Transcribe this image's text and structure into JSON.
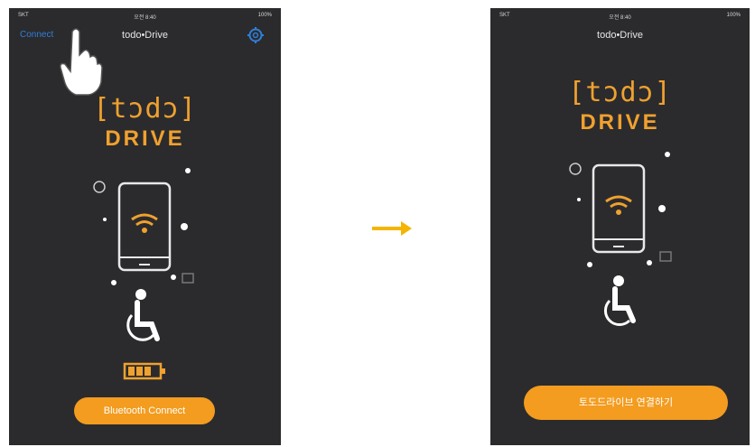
{
  "left_screen": {
    "status_bar": {
      "carrier": "SKT",
      "time": "오전 8:40",
      "battery": "100%"
    },
    "nav": {
      "title": "todo•Drive",
      "left_button": "Connect"
    },
    "logo": {
      "line1": "[tɔdɔ]",
      "line2": "DRIVE"
    },
    "cta_label": "Bluetooth Connect"
  },
  "right_screen": {
    "status_bar": {
      "carrier": "SKT",
      "time": "오전 8:40",
      "battery": "100%"
    },
    "nav": {
      "title": "todo•Drive"
    },
    "logo": {
      "line1": "[tɔdɔ]",
      "line2": "DRIVE"
    },
    "cta_label": "토도드라이브 연결하기"
  },
  "colors": {
    "accent": "#f39c1f",
    "background": "#2b2b2e",
    "link": "#2f7fd8",
    "arrow": "#f5b400"
  },
  "icons": [
    "gear-icon",
    "hand-pointer-icon",
    "phone-wifi-icon",
    "wheelchair-icon",
    "battery-icon",
    "arrow-right-icon"
  ]
}
